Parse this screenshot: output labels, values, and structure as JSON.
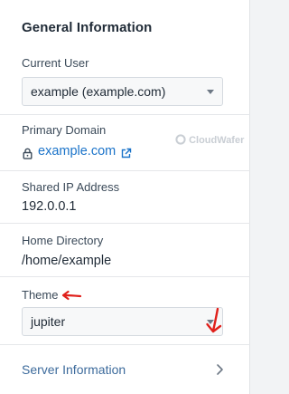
{
  "panel": {
    "title": "General Information"
  },
  "current_user": {
    "label": "Current User",
    "selected": "example (example.com)"
  },
  "primary_domain": {
    "label": "Primary Domain",
    "link_text": "example.com",
    "lock_icon": "lock-icon",
    "external_icon": "external-link-icon"
  },
  "watermark": {
    "text": "CloudWafer"
  },
  "shared_ip": {
    "label": "Shared IP Address",
    "value": "192.0.0.1"
  },
  "home_directory": {
    "label": "Home Directory",
    "value": "/home/example"
  },
  "theme": {
    "label": "Theme",
    "selected": "jupiter"
  },
  "server_information": {
    "label": "Server Information",
    "chevron_icon": "chevron-right-icon"
  },
  "colors": {
    "accent": "#1a73c9",
    "annotation_arrow": "#e0201b",
    "text": "#1f2a36"
  }
}
